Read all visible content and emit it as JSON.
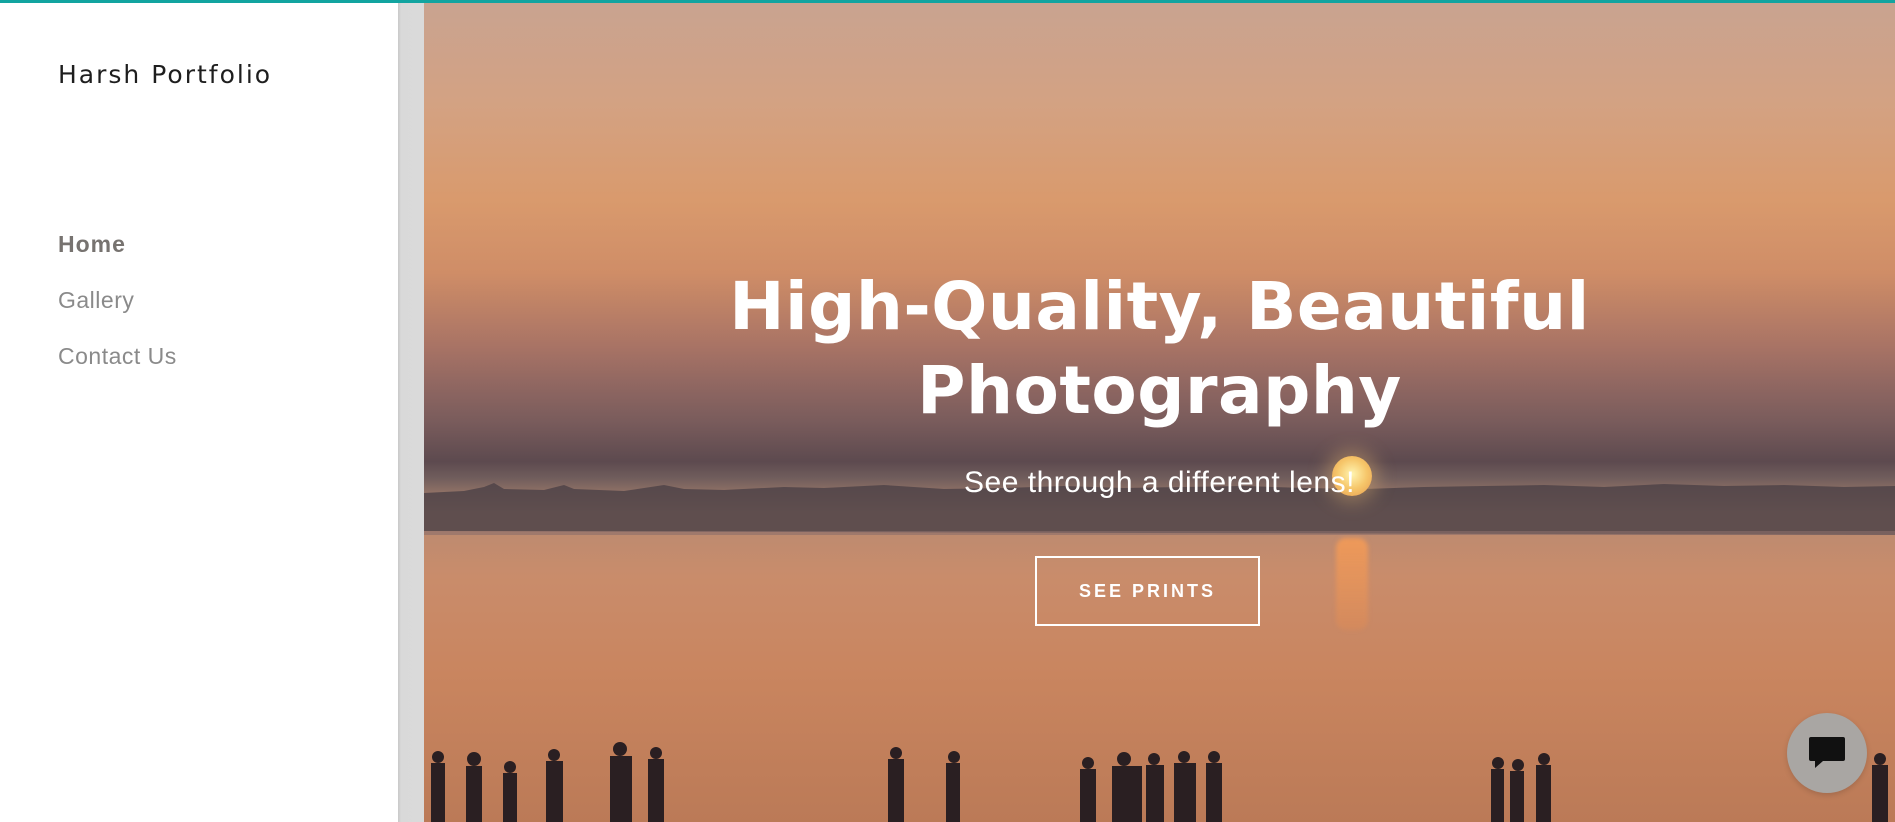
{
  "site": {
    "title": "Harsh Portfolio"
  },
  "nav": {
    "items": [
      {
        "label": "Home",
        "active": true
      },
      {
        "label": "Gallery",
        "active": false
      },
      {
        "label": "Contact Us",
        "active": false
      }
    ]
  },
  "hero": {
    "title_line1": "High-Quality, Beautiful",
    "title_line2": "Photography",
    "subtitle": "See through a different lens!",
    "cta_label": "SEE PRINTS",
    "image_description_icon": "sunset-lake-photo"
  },
  "chat": {
    "icon": "chat-bubble-icon"
  },
  "colors": {
    "accent": "#12a4a0",
    "nav_active": "#777370",
    "nav_inactive": "#8a8a8a",
    "chat_button": "#a9a6a3"
  }
}
